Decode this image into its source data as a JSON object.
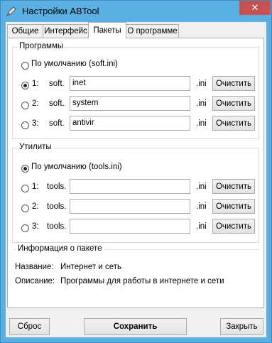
{
  "window": {
    "title": "Настройки ABTool",
    "close_symbol": "✕",
    "icon": "pen-icon"
  },
  "tabs": [
    {
      "label": "Общие",
      "active": false
    },
    {
      "label": "Интерфейс",
      "active": false
    },
    {
      "label": "Пакеты",
      "active": true
    },
    {
      "label": "О программе",
      "active": false
    }
  ],
  "programs": {
    "title": "Программы",
    "default_label": "По умолчанию (soft.ini)",
    "default_checked": false,
    "rows": [
      {
        "num": "1:",
        "prefix": "soft.",
        "value": "inet",
        "suffix": ".ini",
        "clear": "Очистить",
        "checked": true
      },
      {
        "num": "2:",
        "prefix": "soft.",
        "value": "system",
        "suffix": ".ini",
        "clear": "Очистить",
        "checked": false
      },
      {
        "num": "3:",
        "prefix": "soft.",
        "value": "antivir",
        "suffix": ".ini",
        "clear": "Очистить",
        "checked": false
      }
    ]
  },
  "utilities": {
    "title": "Утилиты",
    "default_label": "По умолчанию (tools.ini)",
    "default_checked": true,
    "rows": [
      {
        "num": "1:",
        "prefix": "tools.",
        "value": "",
        "suffix": ".ini",
        "clear": "Очистить",
        "checked": false
      },
      {
        "num": "2:",
        "prefix": "tools.",
        "value": "",
        "suffix": ".ini",
        "clear": "Очистить",
        "checked": false
      },
      {
        "num": "3:",
        "prefix": "tools.",
        "value": "",
        "suffix": ".ini",
        "clear": "Очистить",
        "checked": false
      }
    ]
  },
  "package_info": {
    "title": "Информация о пакете",
    "name_label": "Название:",
    "name_value": "Интернет и сеть",
    "desc_label": "Описание:",
    "desc_value": "Программы для работы в интернете и сети"
  },
  "footer": {
    "reset": "Сброс",
    "save": "Сохранить",
    "close": "Закрыть"
  }
}
